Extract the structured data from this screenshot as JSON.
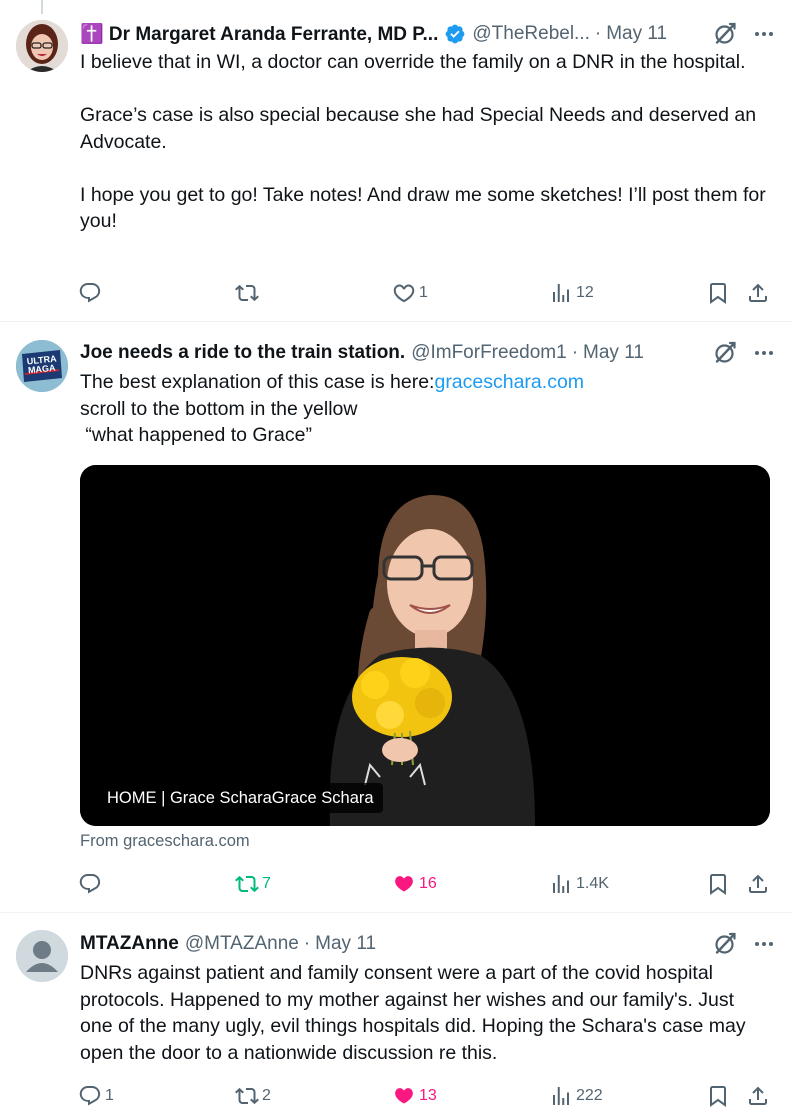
{
  "tweets": [
    {
      "name": "✝️ Dr Margaret Aranda Ferrante, MD P...",
      "handle": "@TheRebel...",
      "date": "May 11",
      "text": "I believe that in WI, a doctor can override the family on a DNR in the hospital.\n\nGrace’s case is also special because she had Special Needs and deserved an Advocate.\n\nI hope you get to go! Take notes! And draw me some sketches! I’ll post them for you!",
      "replies": "",
      "reposts": "",
      "likes": "1",
      "views": "12"
    },
    {
      "name": "Joe needs a ride to the train station.",
      "handle": "@ImForFreedom1",
      "date": "May 11",
      "text_before_link": "The best explanation of this case is here:",
      "link": "graceschara.com",
      "text_after_link": "\nscroll to the bottom in the yellow\n “what happened to Grace”",
      "card_caption": "HOME | Grace ScharaGrace Schara",
      "card_source": "From graceschara.com",
      "replies": "",
      "reposts": "7",
      "likes": "16",
      "views": "1.4K"
    },
    {
      "name": "MTAZAnne",
      "handle": "@MTAZAnne",
      "date": "May 11",
      "text": "DNRs against patient and family consent were a part of the covid hospital protocols. Happened to my mother against her wishes and our family's. Just one of the many ugly, evil things hospitals did. Hoping the Schara's case may open the door to a nationwide discussion re this.",
      "replies": "1",
      "reposts": "2",
      "likes": "13",
      "views": "222"
    }
  ],
  "ui": {
    "dot": "·",
    "icons": [
      "reply-icon",
      "repost-icon",
      "like-icon",
      "views-icon",
      "bookmark-icon",
      "share-icon",
      "grok-icon",
      "more-icon",
      "verified-badge-icon"
    ],
    "colors": {
      "text": "#0f1419",
      "secondary": "#536471",
      "link": "#1d9bf0",
      "repost_active": "#00ba7c",
      "like_active": "#f91880",
      "verified": "#1d9bf0"
    }
  }
}
